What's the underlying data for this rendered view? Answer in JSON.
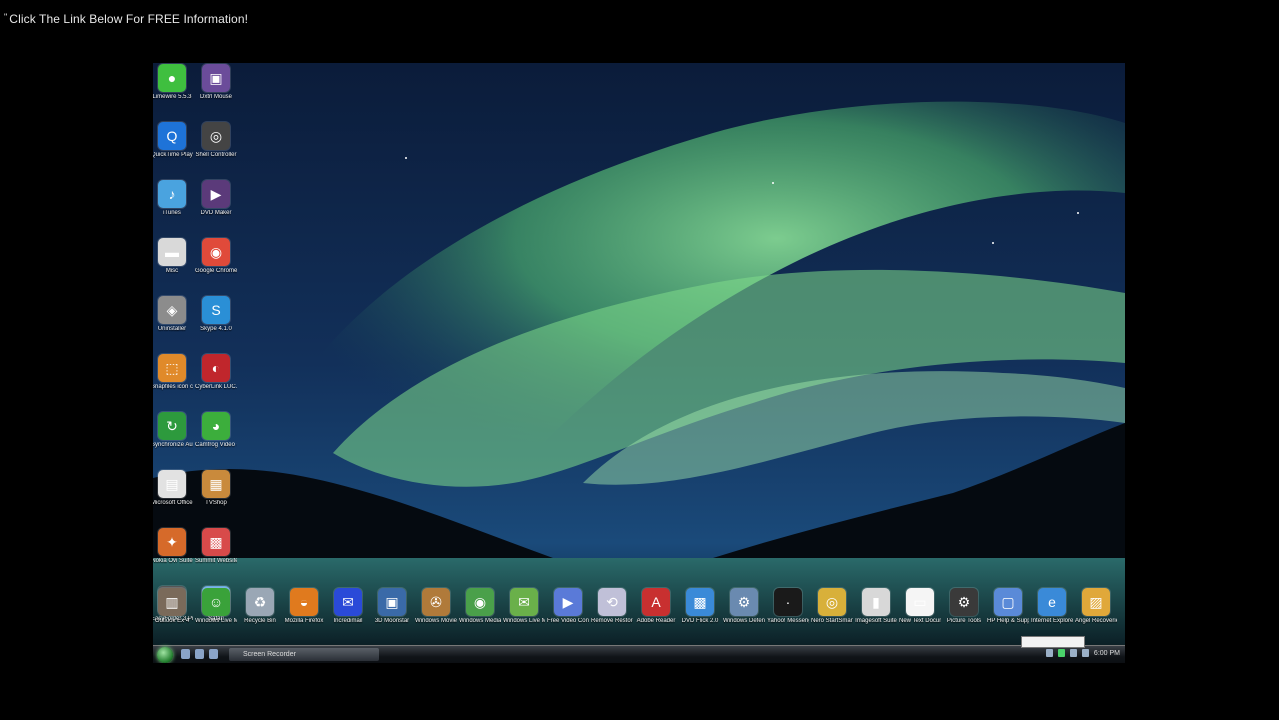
{
  "banner": {
    "bullet": "\"",
    "text": "Click The Link Below For FREE Information!"
  },
  "desktop_icons_column": [
    {
      "label": "Limewire 5.5.3",
      "icon": "limewire-icon",
      "color": "#3fbf3f",
      "glyph": "●"
    },
    {
      "label": "Dxtrl Mouse",
      "icon": "app-icon",
      "color": "#6b4c9a",
      "glyph": "▣"
    },
    {
      "label": "QuickTime Player",
      "icon": "quicktime-icon",
      "color": "#1e73d8",
      "glyph": "Q"
    },
    {
      "label": "Shell Controller",
      "icon": "app-icon",
      "color": "#444444",
      "glyph": "◎"
    },
    {
      "label": "iTunes",
      "icon": "itunes-icon",
      "color": "#4aa3df",
      "glyph": "♪"
    },
    {
      "label": "DVD Maker",
      "icon": "dvd-maker-icon",
      "color": "#5b3a7a",
      "glyph": "▶"
    },
    {
      "label": "Misc",
      "icon": "folder-icon",
      "color": "#d9d9d9",
      "glyph": "▬"
    },
    {
      "label": "Google Chrome",
      "icon": "chrome-icon",
      "color": "#e04a3a",
      "glyph": "◉"
    },
    {
      "label": "Uninstaller",
      "icon": "app-icon",
      "color": "#8c8c8c",
      "glyph": "◈"
    },
    {
      "label": "Skype 4.1.0",
      "icon": "skype-icon",
      "color": "#2a8fd6",
      "glyph": "S"
    },
    {
      "label": "Snapfiles icon converter",
      "icon": "app-icon",
      "color": "#e08a2a",
      "glyph": "⬚"
    },
    {
      "label": "CyberLink LUC.IP...",
      "icon": "app-icon",
      "color": "#c0262c",
      "glyph": "◐"
    },
    {
      "label": "Synchronize Audio...",
      "icon": "app-icon",
      "color": "#2d9a3d",
      "glyph": "↻"
    },
    {
      "label": "Camfrog Video C...",
      "icon": "camfrog-icon",
      "color": "#3cae3c",
      "glyph": "◕"
    },
    {
      "label": "Microsoft Office ...",
      "icon": "office-icon",
      "color": "#e2e2e2",
      "glyph": "▤"
    },
    {
      "label": "TVShop",
      "icon": "app-icon",
      "color": "#c98a3c",
      "glyph": "▦"
    },
    {
      "label": "Nokia Ovi Suite",
      "icon": "app-icon",
      "color": "#d66a2a",
      "glyph": "✦"
    },
    {
      "label": "Summit Websites",
      "icon": "app-icon",
      "color": "#d84a4a",
      "glyph": "▩"
    },
    {
      "label": "EasyFolder 3 Pro",
      "icon": "app-icon",
      "color": "#555555",
      "glyph": "╱"
    },
    {
      "label": "Safari",
      "icon": "safari-icon",
      "color": "#6aa8e0",
      "glyph": "◍"
    }
  ],
  "desktop_icons_row": [
    {
      "label": "Outlook Ex 4",
      "icon": "app-icon",
      "color": "#7a6a5a",
      "glyph": "▥"
    },
    {
      "label": "Windows Live Mes...",
      "icon": "messenger-icon",
      "color": "#3aa23a",
      "glyph": "☺"
    },
    {
      "label": "Recycle Bin",
      "icon": "recycle-bin-icon",
      "color": "#9aa7b5",
      "glyph": "♻"
    },
    {
      "label": "Mozilla Firefox",
      "icon": "firefox-icon",
      "color": "#e07a1e",
      "glyph": "◒"
    },
    {
      "label": "Incredimail",
      "icon": "app-icon",
      "color": "#2a4ad8",
      "glyph": "✉"
    },
    {
      "label": "3D Moonstar",
      "icon": "app-icon",
      "color": "#3a6aa8",
      "glyph": "▣"
    },
    {
      "label": "Windows Movie Maker",
      "icon": "movie-maker-icon",
      "color": "#b07a3a",
      "glyph": "✇"
    },
    {
      "label": "Windows Media Center",
      "icon": "media-center-icon",
      "color": "#4aa04a",
      "glyph": "◉"
    },
    {
      "label": "Windows Live Mail",
      "icon": "app-icon",
      "color": "#6ab04a",
      "glyph": "✉"
    },
    {
      "label": "Free Video Converter",
      "icon": "app-icon",
      "color": "#5a7ad8",
      "glyph": "▶"
    },
    {
      "label": "Remove Restore",
      "icon": "app-icon",
      "color": "#c0c0d8",
      "glyph": "⟲"
    },
    {
      "label": "Adobe Reader",
      "icon": "adobe-icon",
      "color": "#c83030",
      "glyph": "A"
    },
    {
      "label": "DVD Flick 2.0",
      "icon": "app-icon",
      "color": "#3a8ad8",
      "glyph": "▩"
    },
    {
      "label": "Windows Defender",
      "icon": "app-icon",
      "color": "#6a8ab0",
      "glyph": "⚙"
    },
    {
      "label": "Yahoo! Messenger",
      "icon": "app-icon",
      "color": "#1a1a1a",
      "glyph": "·"
    },
    {
      "label": "Nero StartSmart",
      "icon": "nero-icon",
      "color": "#d8b03a",
      "glyph": "◎"
    },
    {
      "label": "Imagesoft Suite",
      "icon": "app-icon",
      "color": "#d8d8d8",
      "glyph": "▮"
    },
    {
      "label": "New Text Document",
      "icon": "text-document-icon",
      "color": "#f5f5f5",
      "glyph": "▭"
    },
    {
      "label": "Picture Tools",
      "icon": "gear-icon",
      "color": "#3a3a3a",
      "glyph": "⚙"
    },
    {
      "label": "HP Help & Support",
      "icon": "computer-icon",
      "color": "#5a8ad8",
      "glyph": "▢"
    },
    {
      "label": "Internet Explorer",
      "icon": "internet-explorer-icon",
      "color": "#3a8ad8",
      "glyph": "e"
    },
    {
      "label": "Angel Recoveries",
      "icon": "app-icon",
      "color": "#e0a83a",
      "glyph": "▨"
    }
  ],
  "taskbar": {
    "task_button": "Screen Recorder",
    "clock": "6:00 PM",
    "tooltip": ""
  }
}
